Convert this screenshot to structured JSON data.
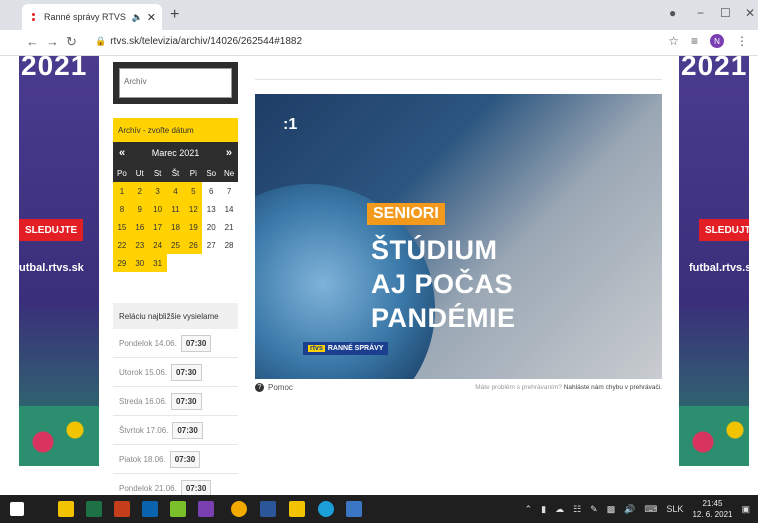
{
  "browser": {
    "tab_title": "Ranné správy RTVS - RTVS.sk",
    "tab_audio_icon": "speaker-icon",
    "tab_close": "✕",
    "new_tab": "+",
    "url": "rtvs.sk/televizia/archiv/14026/262544#1882",
    "profile_initial": "N",
    "window_minimize": "−",
    "window_maximize": "☐",
    "window_close": "✕"
  },
  "ads": {
    "year": "2021",
    "follow_label": "SLEDUJTE",
    "left_site": "utbal.rtvs.sk",
    "right_site": "futbal.rtvs.s",
    "accent": "#e31e24"
  },
  "archive": {
    "search_placeholder": "Archív"
  },
  "calendar": {
    "header": "Archív - zvoľte dátum",
    "prev": "«",
    "next": "»",
    "month": "Marec 2021",
    "weekdays": [
      "Po",
      "Ut",
      "St",
      "Št",
      "Pi",
      "So",
      "Ne"
    ],
    "weeks": [
      [
        "1",
        "2",
        "3",
        "4",
        "5",
        "6",
        "7"
      ],
      [
        "8",
        "9",
        "10",
        "11",
        "12",
        "13",
        "14"
      ],
      [
        "15",
        "16",
        "17",
        "18",
        "19",
        "20",
        "21"
      ],
      [
        "22",
        "23",
        "24",
        "25",
        "26",
        "27",
        "28"
      ],
      [
        "29",
        "30",
        "31",
        "",
        "",
        "",
        ""
      ]
    ],
    "active_color": "#ffd200"
  },
  "next_broadcasts": {
    "title": "Reláciu najbližšie vysielame",
    "items": [
      {
        "day": "Pondelok 14.06.",
        "time": "07:30"
      },
      {
        "day": "Utorok 15.06.",
        "time": "07:30"
      },
      {
        "day": "Streda 16.06.",
        "time": "07:30"
      },
      {
        "day": "Štvrtok 17.06.",
        "time": "07:30"
      },
      {
        "day": "Piatok 18.06.",
        "time": "07:30"
      },
      {
        "day": "Pondelok 21.06.",
        "time": "07:30"
      }
    ]
  },
  "video": {
    "channel": ":1",
    "tag": "SENIORI",
    "headline": [
      "ŠTÚDIUM",
      "AJ POČAS",
      "PANDÉMIE"
    ],
    "program_logo_rtvs": "rtvs",
    "program_logo_name": "RANNÉ SPRÁVY",
    "tag_color": "#f39a1d"
  },
  "help": {
    "label": "Pomoc",
    "icon": "?",
    "problem_text": "Máte problém s prehrávaním?",
    "problem_link": "Nahláste nám chybu v prehrávači."
  },
  "taskbar": {
    "lang": "SLK",
    "time": "21:45",
    "date": "12. 6. 2021"
  }
}
